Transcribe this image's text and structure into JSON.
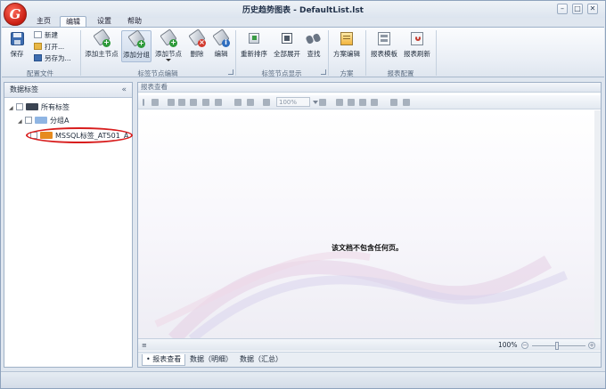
{
  "window": {
    "title": "历史趋势图表 - DefaultList.lst",
    "app_logo_letter": "G"
  },
  "menu_tabs": [
    {
      "label": "主页"
    },
    {
      "label": "编辑"
    },
    {
      "label": "设置"
    },
    {
      "label": "帮助"
    }
  ],
  "ribbon": {
    "file_group": {
      "save": "保存",
      "new": "新建",
      "open": "打开...",
      "save_as": "另存为...",
      "group_label": "配置文件"
    },
    "tag_edit_group": {
      "add_main": "添加主节点",
      "add_group": "添加分组",
      "add_node": "添加节点",
      "delete": "删除",
      "edit": "编辑",
      "group_label": "标签节点编辑"
    },
    "tag_display_group": {
      "resort": "重新排序",
      "expand_all": "全部展开",
      "find": "查找",
      "group_label": "标签节点显示"
    },
    "scheme_group": {
      "scheme_edit": "方案编辑",
      "group_label": "方案"
    },
    "report_group": {
      "report_template": "报表模板",
      "report_refresh": "报表刷新",
      "group_label": "报表配置"
    }
  },
  "left_panel": {
    "title": "数据标签",
    "collapse_glyph": "«",
    "tree": {
      "root_label": "所有标签",
      "group_label": "分组A",
      "tag_label": "MSSQL标签_AT501_A"
    }
  },
  "right_panel": {
    "title": "报表查看",
    "zoom_box": "100%",
    "empty_message": "该文档不包含任何页。",
    "status": {
      "zoom_percent": "100%"
    },
    "bottom_tabs": [
      {
        "label": "• 报表查看"
      },
      {
        "label": "数据（明细）"
      },
      {
        "label": "数据（汇总）"
      }
    ]
  },
  "colors": {
    "accent": "#2f6ebf",
    "highlight_ring": "#d81e1e",
    "tag_badge": "#e68a1e"
  }
}
